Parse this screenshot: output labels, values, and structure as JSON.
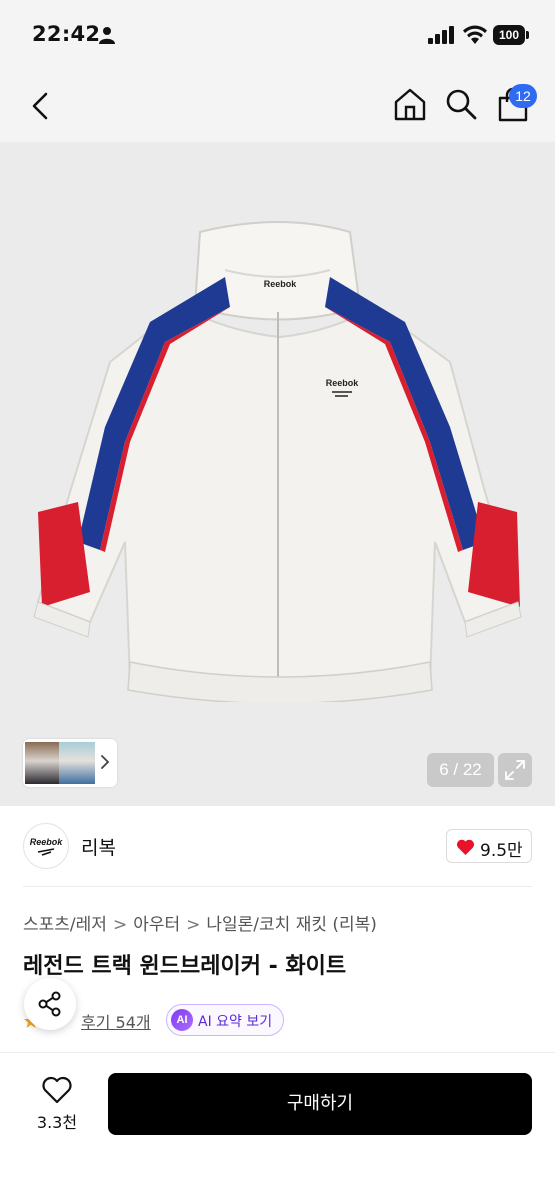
{
  "status_bar": {
    "time": "22:42",
    "battery": "100"
  },
  "nav": {
    "cart_count": "12"
  },
  "gallery": {
    "counter": "6 / 22"
  },
  "brand": {
    "logo_text": "Reebok",
    "name": "리복",
    "likes": "9.5만"
  },
  "product": {
    "breadcrumbs": [
      "스포츠/레저",
      "아우터",
      "나일론/코치 재킷 (리복)"
    ],
    "breadcrumb_separator": ">",
    "title": "레전드 트랙 윈드브레이커 - 화이트",
    "reviews_label": "후기 54개",
    "ai_badge": "AI",
    "ai_summary_label": "AI 요약 보기"
  },
  "bottom_bar": {
    "wishlist_count": "3.3천",
    "buy_label": "구매하기"
  },
  "colors": {
    "badge_blue": "#2f6bf2",
    "heart_red": "#e8132b",
    "ai_purple": "#7b3cf0",
    "buy_black": "#000000"
  },
  "icons": [
    "person-icon",
    "signal-icon",
    "wifi-icon",
    "battery-icon",
    "back-arrow-icon",
    "home-icon",
    "search-icon",
    "shopping-bag-icon",
    "chevron-right-icon",
    "expand-icon",
    "heart-icon",
    "star-icon",
    "share-icon",
    "heart-outline-icon"
  ]
}
